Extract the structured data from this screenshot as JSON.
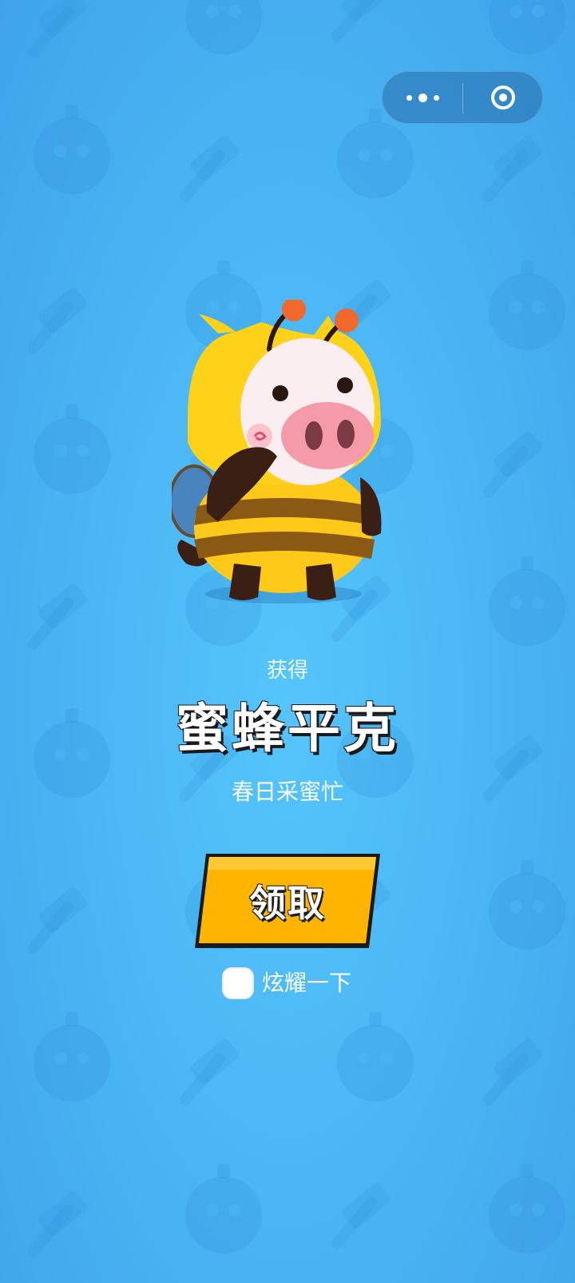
{
  "capsule": {
    "more_icon": "more-dots-icon",
    "close_icon": "close-target-icon"
  },
  "reward": {
    "label": "获得",
    "name": "蜜蜂平克",
    "subtitle": "春日采蜜忙",
    "character_icon": "bee-pig-character"
  },
  "actions": {
    "claim_label": "领取",
    "show_off_label": "炫耀一下",
    "show_off_checked": false
  },
  "colors": {
    "background": "#4bb7f5",
    "button": "#ffb400",
    "bee_yellow": "#ffd21a",
    "pig_pink": "#f49aa8"
  }
}
